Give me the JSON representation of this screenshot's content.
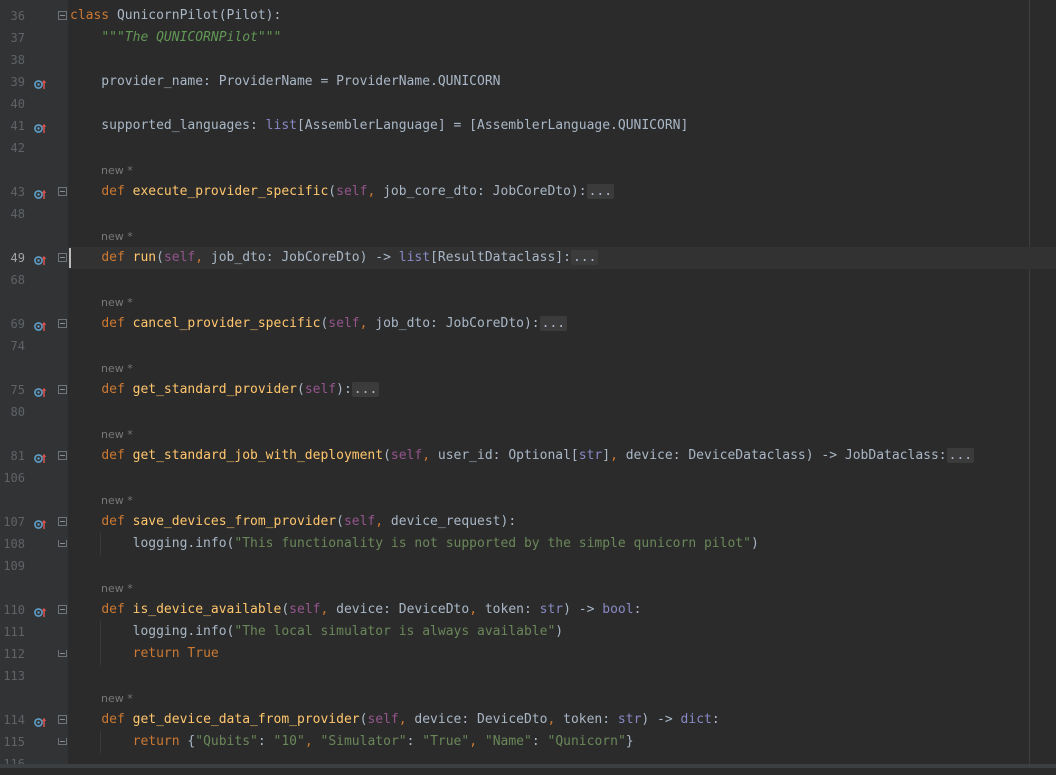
{
  "editor": {
    "lines": [
      {
        "n": "36",
        "hint": null,
        "icon": false,
        "fold": "open-start",
        "tokens": [
          [
            "kw",
            "class"
          ],
          [
            "op",
            " QunicornPilot(Pilot):"
          ]
        ]
      },
      {
        "n": "37",
        "hint": null,
        "icon": false,
        "fold": null,
        "tokens": [
          [
            "op",
            "    "
          ],
          [
            "doc",
            "\"\"\"The QUNICORNPilot\"\"\""
          ]
        ]
      },
      {
        "n": "38",
        "hint": null,
        "icon": false,
        "fold": null,
        "tokens": []
      },
      {
        "n": "39",
        "hint": null,
        "icon": true,
        "fold": null,
        "tokens": [
          [
            "op",
            "    provider_name: ProviderName = ProviderName.QUNICORN"
          ]
        ]
      },
      {
        "n": "40",
        "hint": null,
        "icon": false,
        "fold": null,
        "tokens": []
      },
      {
        "n": "41",
        "hint": null,
        "icon": true,
        "fold": null,
        "tokens": [
          [
            "op",
            "    supported_languages: "
          ],
          [
            "bi",
            "list"
          ],
          [
            "op",
            "[AssemblerLanguage] = [AssemblerLanguage.QUNICORN]"
          ]
        ]
      },
      {
        "n": "42",
        "hint": null,
        "icon": false,
        "fold": null,
        "tokens": []
      },
      {
        "n": "43",
        "hint": "new *",
        "icon": true,
        "fold": "collapsed",
        "tokens": [
          [
            "op",
            "    "
          ],
          [
            "kw",
            "def "
          ],
          [
            "fn",
            "execute_provider_specific"
          ],
          [
            "op",
            "("
          ],
          [
            "self",
            "self"
          ],
          [
            "kw",
            ", "
          ],
          [
            "op",
            "job_core_dto: JobCoreDto):"
          ],
          [
            "fold",
            "..."
          ]
        ]
      },
      {
        "n": "48",
        "hint": null,
        "icon": false,
        "fold": null,
        "tokens": []
      },
      {
        "n": "49",
        "hint": "new *",
        "icon": true,
        "fold": "collapsed",
        "current": true,
        "tokens": [
          [
            "op",
            "    "
          ],
          [
            "kw",
            "def "
          ],
          [
            "fn",
            "run"
          ],
          [
            "op",
            "("
          ],
          [
            "self",
            "self"
          ],
          [
            "kw",
            ", "
          ],
          [
            "op",
            "job_dto: JobCoreDto) -> "
          ],
          [
            "bi",
            "list"
          ],
          [
            "op",
            "[ResultDataclass]:"
          ],
          [
            "fold",
            "..."
          ]
        ]
      },
      {
        "n": "68",
        "hint": null,
        "icon": false,
        "fold": null,
        "tokens": []
      },
      {
        "n": "69",
        "hint": "new *",
        "icon": true,
        "fold": "collapsed",
        "tokens": [
          [
            "op",
            "    "
          ],
          [
            "kw",
            "def "
          ],
          [
            "fn",
            "cancel_provider_specific"
          ],
          [
            "op",
            "("
          ],
          [
            "self",
            "self"
          ],
          [
            "kw",
            ", "
          ],
          [
            "op",
            "job_dto: JobCoreDto):"
          ],
          [
            "fold",
            "..."
          ]
        ]
      },
      {
        "n": "74",
        "hint": null,
        "icon": false,
        "fold": null,
        "tokens": []
      },
      {
        "n": "75",
        "hint": "new *",
        "icon": true,
        "fold": "collapsed",
        "tokens": [
          [
            "op",
            "    "
          ],
          [
            "kw",
            "def "
          ],
          [
            "fn",
            "get_standard_provider"
          ],
          [
            "op",
            "("
          ],
          [
            "self",
            "self"
          ],
          [
            "op",
            "):"
          ],
          [
            "fold",
            "..."
          ]
        ]
      },
      {
        "n": "80",
        "hint": null,
        "icon": false,
        "fold": null,
        "tokens": []
      },
      {
        "n": "81",
        "hint": "new *",
        "icon": true,
        "fold": "collapsed",
        "tokens": [
          [
            "op",
            "    "
          ],
          [
            "kw",
            "def "
          ],
          [
            "fn",
            "get_standard_job_with_deployment"
          ],
          [
            "op",
            "("
          ],
          [
            "self",
            "self"
          ],
          [
            "kw",
            ", "
          ],
          [
            "op",
            "user_id: Optional["
          ],
          [
            "bi",
            "str"
          ],
          [
            "op",
            "]"
          ],
          [
            "kw",
            ", "
          ],
          [
            "op",
            "device: DeviceDataclass) -> JobDataclass:"
          ],
          [
            "fold",
            "..."
          ]
        ]
      },
      {
        "n": "106",
        "hint": null,
        "icon": false,
        "fold": null,
        "tokens": []
      },
      {
        "n": "107",
        "hint": "new *",
        "icon": true,
        "fold": "open-start",
        "tokens": [
          [
            "op",
            "    "
          ],
          [
            "kw",
            "def "
          ],
          [
            "fn",
            "save_devices_from_provider"
          ],
          [
            "op",
            "("
          ],
          [
            "self",
            "self"
          ],
          [
            "kw",
            ", "
          ],
          [
            "op",
            "device_request):"
          ]
        ]
      },
      {
        "n": "108",
        "hint": null,
        "icon": false,
        "fold": "open-end",
        "guide": true,
        "tokens": [
          [
            "op",
            "        logging.info("
          ],
          [
            "str",
            "\"This functionality is not supported by the simple qunicorn pilot\""
          ],
          [
            "op",
            ")"
          ]
        ]
      },
      {
        "n": "109",
        "hint": null,
        "icon": false,
        "fold": null,
        "tokens": []
      },
      {
        "n": "110",
        "hint": "new *",
        "icon": true,
        "fold": "open-start",
        "tokens": [
          [
            "op",
            "    "
          ],
          [
            "kw",
            "def "
          ],
          [
            "fn",
            "is_device_available"
          ],
          [
            "op",
            "("
          ],
          [
            "self",
            "self"
          ],
          [
            "kw",
            ", "
          ],
          [
            "op",
            "device: DeviceDto"
          ],
          [
            "kw",
            ", "
          ],
          [
            "op",
            "token: "
          ],
          [
            "bi",
            "str"
          ],
          [
            "op",
            ") -> "
          ],
          [
            "bi",
            "bool"
          ],
          [
            "op",
            ":"
          ]
        ]
      },
      {
        "n": "111",
        "hint": null,
        "icon": false,
        "fold": null,
        "guide": true,
        "tokens": [
          [
            "op",
            "        logging.info("
          ],
          [
            "str",
            "\"The local simulator is always available\""
          ],
          [
            "op",
            ")"
          ]
        ]
      },
      {
        "n": "112",
        "hint": null,
        "icon": false,
        "fold": "open-end",
        "guide": true,
        "tokens": [
          [
            "op",
            "        "
          ],
          [
            "kw",
            "return True"
          ]
        ]
      },
      {
        "n": "113",
        "hint": null,
        "icon": false,
        "fold": null,
        "tokens": []
      },
      {
        "n": "114",
        "hint": "new *",
        "icon": true,
        "fold": "open-start",
        "tokens": [
          [
            "op",
            "    "
          ],
          [
            "kw",
            "def "
          ],
          [
            "fn",
            "get_device_data_from_provider"
          ],
          [
            "op",
            "("
          ],
          [
            "self",
            "self"
          ],
          [
            "kw",
            ", "
          ],
          [
            "op",
            "device: DeviceDto"
          ],
          [
            "kw",
            ", "
          ],
          [
            "op",
            "token: "
          ],
          [
            "bi",
            "str"
          ],
          [
            "op",
            ") -> "
          ],
          [
            "bi",
            "dict"
          ],
          [
            "op",
            ":"
          ]
        ]
      },
      {
        "n": "115",
        "hint": null,
        "icon": false,
        "fold": "open-end",
        "guide": true,
        "tokens": [
          [
            "op",
            "        "
          ],
          [
            "kw",
            "return "
          ],
          [
            "op",
            "{"
          ],
          [
            "str",
            "\"Qubits\""
          ],
          [
            "op",
            ": "
          ],
          [
            "str",
            "\"10\""
          ],
          [
            "kw",
            ", "
          ],
          [
            "str",
            "\"Simulator\""
          ],
          [
            "op",
            ": "
          ],
          [
            "str",
            "\"True\""
          ],
          [
            "kw",
            ", "
          ],
          [
            "str",
            "\"Name\""
          ],
          [
            "op",
            ": "
          ],
          [
            "str",
            "\"Qunicorn\""
          ],
          [
            "op",
            "}"
          ]
        ]
      },
      {
        "n": "116",
        "hint": null,
        "icon": false,
        "fold": null,
        "tokens": []
      }
    ]
  },
  "colors": {
    "background": "#2b2b2b",
    "gutter": "#313335",
    "keyword": "#cc7832",
    "function": "#ffc66d",
    "self": "#94558d",
    "string": "#6a8759",
    "builtin": "#8888c6",
    "text": "#a9b7c6"
  },
  "icons": {
    "gutter_marker": "override-method-icon",
    "fold": "fold-toggle-icon"
  }
}
